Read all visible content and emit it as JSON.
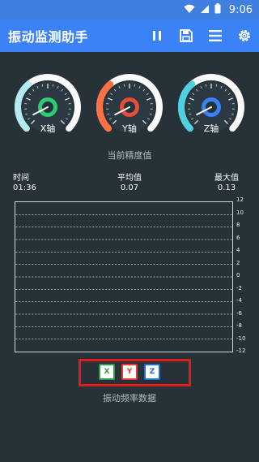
{
  "status_bar": {
    "time": "9:06",
    "icons": [
      "wifi-icon",
      "signal-icon",
      "battery-icon"
    ]
  },
  "app_bar": {
    "title": "振动监测助手",
    "actions": [
      "pause-icon",
      "save-icon",
      "menu-icon",
      "settings-icon"
    ]
  },
  "gauges": [
    {
      "label": "X轴",
      "accent": "#2ecc71",
      "scale": "#b2ebf2",
      "needle": "#ffffff"
    },
    {
      "label": "Y轴",
      "accent": "#e74c3c",
      "scale": "#ff7043",
      "needle": "#ffffff"
    },
    {
      "label": "Z轴",
      "accent": "#3b82f6",
      "scale": "#4dd0e1",
      "needle": "#ffffff"
    }
  ],
  "precision_section": {
    "title": "当前精度值"
  },
  "stats": {
    "time": {
      "label": "时间",
      "value": "01:36"
    },
    "avg": {
      "label": "平均值",
      "value": "0.07"
    },
    "max": {
      "label": "最大值",
      "value": "0.13"
    }
  },
  "chart_data": {
    "type": "line",
    "title": "",
    "xlabel": "",
    "ylabel": "",
    "ylim": [
      -12,
      12
    ],
    "yticks": [
      "12",
      "10",
      "8",
      "6",
      "4",
      "2",
      "0",
      "-2",
      "-4",
      "-6",
      "-8",
      "-10",
      "-12"
    ],
    "grid": true,
    "series": []
  },
  "legend": [
    {
      "label": "X",
      "color": "#2e9d47"
    },
    {
      "label": "Y",
      "color": "#e53935"
    },
    {
      "label": "Z",
      "color": "#1e6fd9"
    }
  ],
  "bottom": {
    "caption": "振动频率数据"
  }
}
